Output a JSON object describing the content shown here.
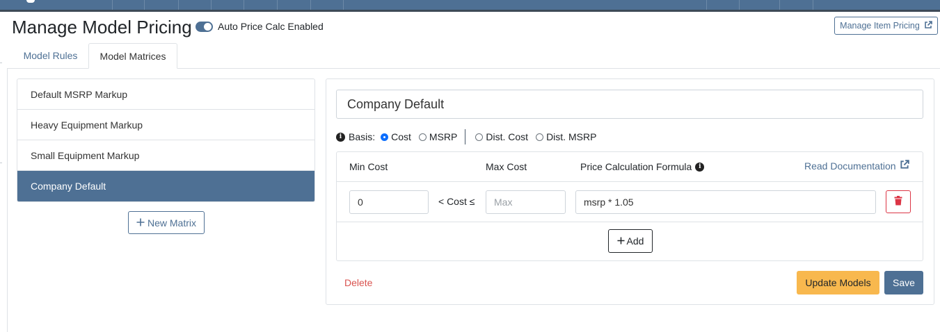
{
  "header": {
    "title": "Manage Model Pricing",
    "auto_price_toggle": {
      "label": "Auto Price Calc Enabled",
      "on": true
    },
    "manage_item_pricing_label": "Manage Item Pricing"
  },
  "tabs": [
    {
      "label": "Model Rules",
      "active": false
    },
    {
      "label": "Model Matrices",
      "active": true
    }
  ],
  "matrices": {
    "items": [
      {
        "label": "Default MSRP Markup",
        "active": false
      },
      {
        "label": "Heavy Equipment Markup",
        "active": false
      },
      {
        "label": "Small Equipment Markup",
        "active": false
      },
      {
        "label": "Company Default",
        "active": true
      }
    ],
    "new_matrix_label": "New Matrix"
  },
  "editor": {
    "name_value": "Company Default",
    "basis": {
      "label": "Basis:",
      "options": [
        {
          "label": "Cost",
          "checked": true
        },
        {
          "label": "MSRP",
          "checked": false
        },
        {
          "label": "Dist. Cost",
          "checked": false
        },
        {
          "label": "Dist. MSRP",
          "checked": false
        }
      ]
    },
    "table": {
      "headers": {
        "min_cost": "Min Cost",
        "max_cost": "Max Cost",
        "formula": "Price Calculation Formula"
      },
      "read_documentation": "Read Documentation",
      "rows": [
        {
          "min_value": "0",
          "operator": "< Cost ≤",
          "max_value": "",
          "max_placeholder": "Max",
          "formula_value": "msrp * 1.05"
        }
      ],
      "add_label": "Add"
    },
    "delete_label": "Delete",
    "update_models_label": "Update Models",
    "save_label": "Save"
  },
  "colors": {
    "primary": "#4e7094",
    "warning": "#f8b84e",
    "danger": "#dc3545",
    "radio_checked": "#0d6efd"
  }
}
